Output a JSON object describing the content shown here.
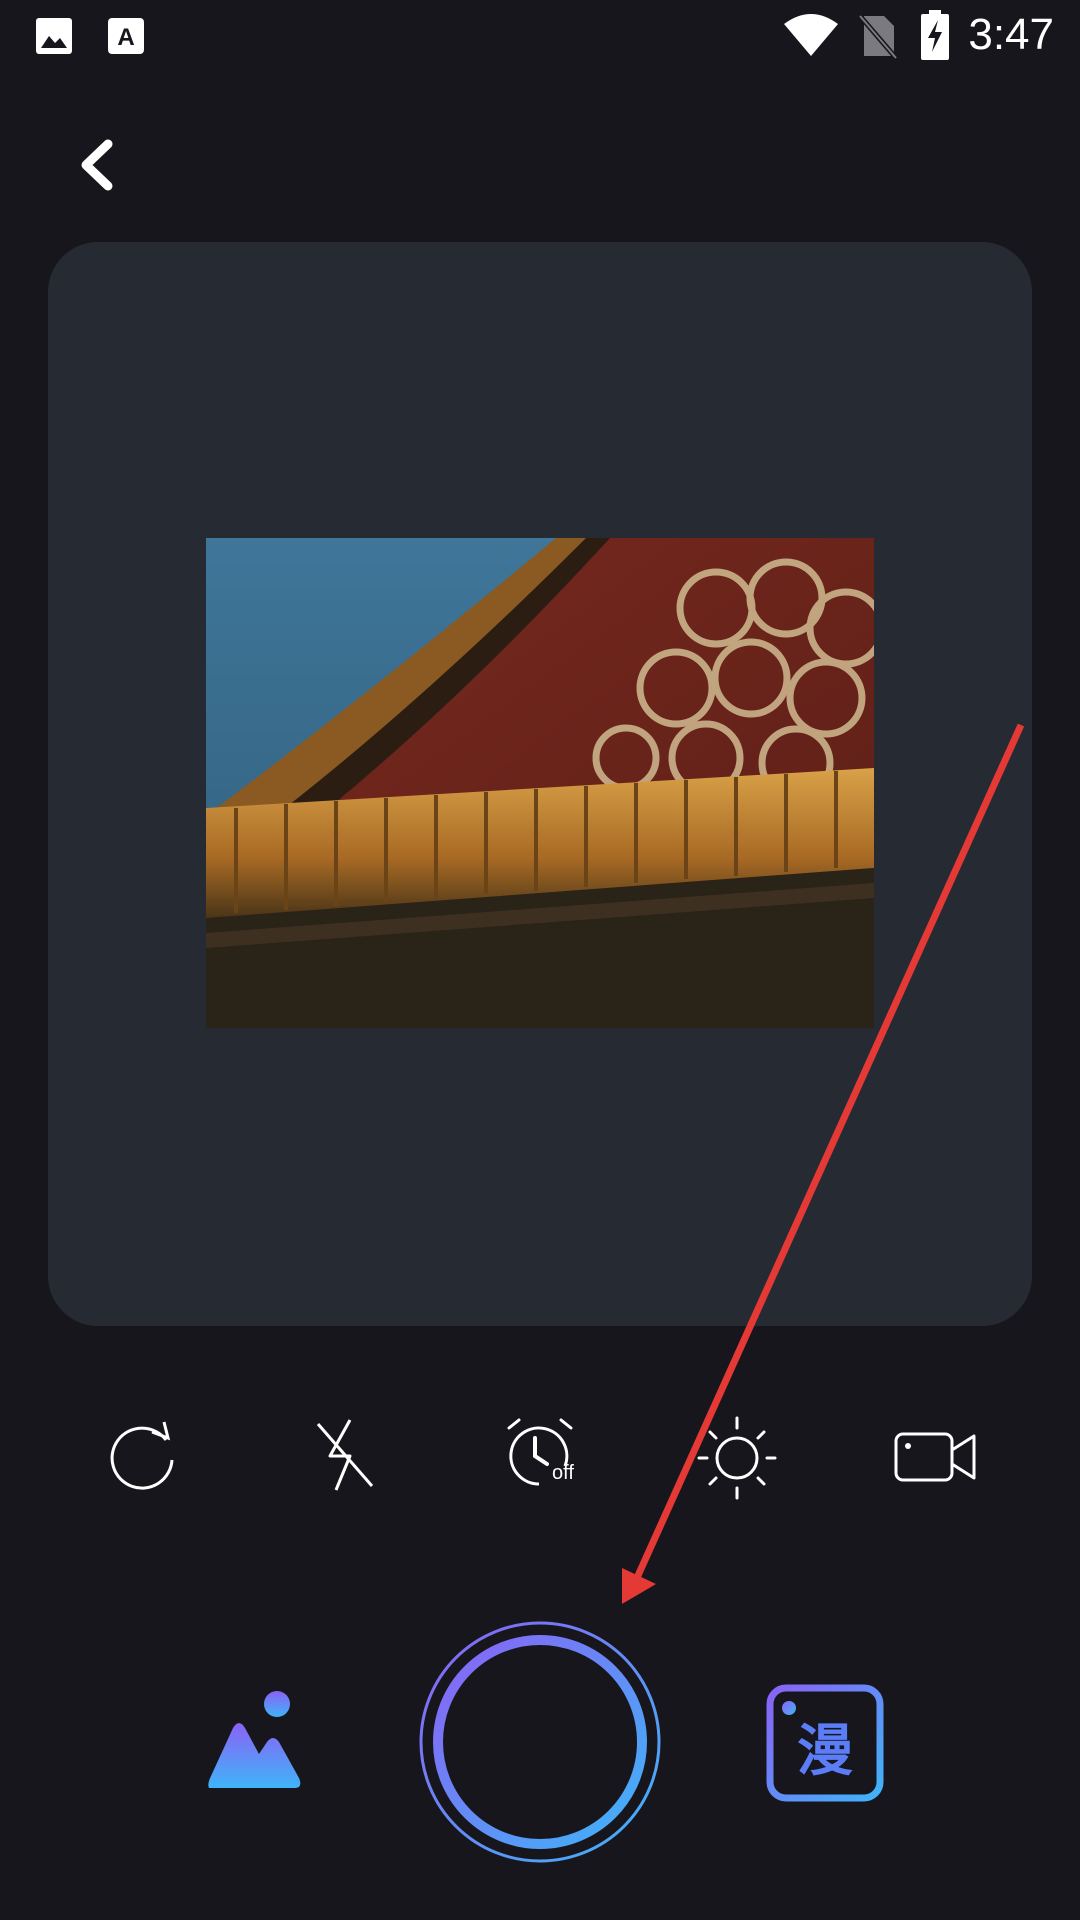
{
  "status_bar": {
    "time": "3:47",
    "left_icons": [
      "image-notification-icon",
      "font-app-notification-icon"
    ],
    "right_icons": [
      "wifi-icon",
      "no-sim-icon",
      "battery-charging-icon"
    ]
  },
  "header": {
    "back_icon": "chevron-left-icon"
  },
  "preview": {
    "image": "palace-roof-photo"
  },
  "toolbar": {
    "items": [
      {
        "icon": "rotate-icon"
      },
      {
        "icon": "flash-off-icon"
      },
      {
        "icon": "timer-icon",
        "label": "off"
      },
      {
        "icon": "brightness-icon"
      },
      {
        "icon": "video-camera-icon"
      }
    ]
  },
  "bottom_bar": {
    "gallery_icon": "gallery-icon",
    "shutter": "shutter-button",
    "comic_label": "漫"
  },
  "colors": {
    "background": "#17161c",
    "panel": "#252a33",
    "accent_start": "#8a62f5",
    "accent_end": "#3fb4f8",
    "annotation": "#e53935"
  }
}
